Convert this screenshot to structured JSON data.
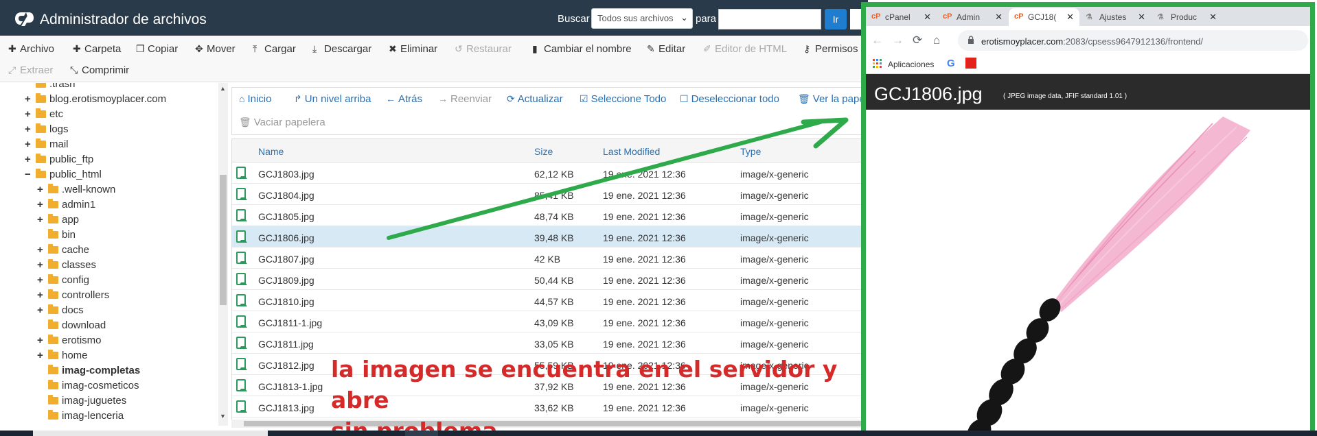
{
  "header": {
    "title": "Administrador de archivos",
    "search_label": "Buscar",
    "scope_value": "Todos sus archivos",
    "for_label": "para",
    "search_value": "",
    "go_label": "Ir"
  },
  "toolbar": [
    {
      "label": "Archivo",
      "icon": "plus-icon",
      "enabled": true
    },
    {
      "label": "Carpeta",
      "icon": "plus-icon",
      "enabled": true
    },
    {
      "label": "Copiar",
      "icon": "copy-icon",
      "enabled": true
    },
    {
      "label": "Mover",
      "icon": "move-icon",
      "enabled": true
    },
    {
      "label": "Cargar",
      "icon": "upload-icon",
      "enabled": true
    },
    {
      "label": "Descargar",
      "icon": "download-icon",
      "enabled": true
    },
    {
      "label": "Eliminar",
      "icon": "times-icon",
      "enabled": true
    },
    {
      "label": "Restaurar",
      "icon": "undo-icon",
      "enabled": false
    },
    {
      "label": "Cambiar el nombre",
      "icon": "file-icon",
      "enabled": true
    },
    {
      "label": "Editar",
      "icon": "pencil-icon",
      "enabled": true
    },
    {
      "label": "Editor de HTML",
      "icon": "edit-icon",
      "enabled": false
    },
    {
      "label": "Permisos",
      "icon": "key-icon",
      "enabled": true
    },
    {
      "label": "Extraer",
      "icon": "expand-icon",
      "enabled": false
    },
    {
      "label": "Comprimir",
      "icon": "compress-icon",
      "enabled": true
    }
  ],
  "tree": [
    {
      "label": ".trash",
      "toggle": "",
      "indent": 0
    },
    {
      "label": "blog.erotismoyplacer.com",
      "toggle": "+",
      "indent": 0
    },
    {
      "label": "etc",
      "toggle": "+",
      "indent": 0
    },
    {
      "label": "logs",
      "toggle": "+",
      "indent": 0
    },
    {
      "label": "mail",
      "toggle": "+",
      "indent": 0
    },
    {
      "label": "public_ftp",
      "toggle": "+",
      "indent": 0
    },
    {
      "label": "public_html",
      "toggle": "−",
      "indent": 0
    },
    {
      "label": ".well-known",
      "toggle": "+",
      "indent": 1
    },
    {
      "label": "admin1",
      "toggle": "+",
      "indent": 1
    },
    {
      "label": "app",
      "toggle": "+",
      "indent": 1
    },
    {
      "label": "bin",
      "toggle": "",
      "indent": 1
    },
    {
      "label": "cache",
      "toggle": "+",
      "indent": 1
    },
    {
      "label": "classes",
      "toggle": "+",
      "indent": 1
    },
    {
      "label": "config",
      "toggle": "+",
      "indent": 1
    },
    {
      "label": "controllers",
      "toggle": "+",
      "indent": 1
    },
    {
      "label": "docs",
      "toggle": "+",
      "indent": 1
    },
    {
      "label": "download",
      "toggle": "",
      "indent": 1
    },
    {
      "label": "erotismo",
      "toggle": "+",
      "indent": 1
    },
    {
      "label": "home",
      "toggle": "+",
      "indent": 1
    },
    {
      "label": "imag-completas",
      "toggle": "",
      "indent": 1,
      "bold": true
    },
    {
      "label": "imag-cosmeticos",
      "toggle": "",
      "indent": 1
    },
    {
      "label": "imag-juguetes",
      "toggle": "",
      "indent": 1
    },
    {
      "label": "imag-lenceria",
      "toggle": "",
      "indent": 1
    }
  ],
  "actions": [
    {
      "label": "Inicio",
      "icon": "home-icon",
      "enabled": true
    },
    {
      "label": "Un nivel arriba",
      "icon": "level-up-icon",
      "enabled": true
    },
    {
      "label": "Atrás",
      "icon": "arrow-left-icon",
      "enabled": true
    },
    {
      "label": "Reenviar",
      "icon": "arrow-right-icon",
      "enabled": false
    },
    {
      "label": "Actualizar",
      "icon": "refresh-icon",
      "enabled": true
    },
    {
      "label": "Seleccione Todo",
      "icon": "check-square-icon",
      "enabled": true
    },
    {
      "label": "Deseleccionar todo",
      "icon": "square-icon",
      "enabled": true
    },
    {
      "label": "Ver la papelera",
      "icon": "trash-icon",
      "enabled": true
    },
    {
      "label": "Vaciar papelera",
      "icon": "trash-icon",
      "enabled": false
    }
  ],
  "columns": [
    "Name",
    "Size",
    "Last Modified",
    "Type"
  ],
  "files": [
    {
      "name": "GCJ1803.jpg",
      "size": "62,12 KB",
      "modified": "19 ene. 2021 12:36",
      "type": "image/x-generic",
      "selected": false
    },
    {
      "name": "GCJ1804.jpg",
      "size": "85,41 KB",
      "modified": "19 ene. 2021 12:36",
      "type": "image/x-generic",
      "selected": false
    },
    {
      "name": "GCJ1805.jpg",
      "size": "48,74 KB",
      "modified": "19 ene. 2021 12:36",
      "type": "image/x-generic",
      "selected": false
    },
    {
      "name": "GCJ1806.jpg",
      "size": "39,48 KB",
      "modified": "19 ene. 2021 12:36",
      "type": "image/x-generic",
      "selected": true
    },
    {
      "name": "GCJ1807.jpg",
      "size": "42 KB",
      "modified": "19 ene. 2021 12:36",
      "type": "image/x-generic",
      "selected": false
    },
    {
      "name": "GCJ1809.jpg",
      "size": "50,44 KB",
      "modified": "19 ene. 2021 12:36",
      "type": "image/x-generic",
      "selected": false
    },
    {
      "name": "GCJ1810.jpg",
      "size": "44,57 KB",
      "modified": "19 ene. 2021 12:36",
      "type": "image/x-generic",
      "selected": false
    },
    {
      "name": "GCJ1811-1.jpg",
      "size": "43,09 KB",
      "modified": "19 ene. 2021 12:36",
      "type": "image/x-generic",
      "selected": false
    },
    {
      "name": "GCJ1811.jpg",
      "size": "33,05 KB",
      "modified": "19 ene. 2021 12:36",
      "type": "image/x-generic",
      "selected": false
    },
    {
      "name": "GCJ1812.jpg",
      "size": "55,59 KB",
      "modified": "19 ene. 2021 12:36",
      "type": "image/x-generic",
      "selected": false
    },
    {
      "name": "GCJ1813-1.jpg",
      "size": "37,92 KB",
      "modified": "19 ene. 2021 12:36",
      "type": "image/x-generic",
      "selected": false
    },
    {
      "name": "GCJ1813.jpg",
      "size": "33,62 KB",
      "modified": "19 ene. 2021 12:36",
      "type": "image/x-generic",
      "selected": false
    }
  ],
  "annotation": {
    "line1": "la imagen se encuentra en el servidor y abre",
    "line2": "sin problema",
    "color": "#d42a2a",
    "arrow_color": "#2eaa4a"
  },
  "browser": {
    "tabs": [
      {
        "label": "cPanel",
        "icon": "cpanel-icon",
        "active": false
      },
      {
        "label": "Admin",
        "icon": "cpanel-icon",
        "active": false
      },
      {
        "label": "GCJ18(",
        "icon": "cpanel-icon",
        "active": true
      },
      {
        "label": "Ajustes",
        "icon": "flask-icon",
        "active": false
      },
      {
        "label": "Produc",
        "icon": "flask-icon",
        "active": false
      }
    ],
    "url_host": "erotismoyplacer.com",
    "url_path": ":2083/cpsess9647912136/frontend/",
    "bookmark_apps": "Aplicaciones",
    "image_title": "GCJ1806.jpg",
    "image_subtitle": "( JPEG image data, JFIF standard 1.01 )",
    "border_color": "#2eaa4a"
  }
}
